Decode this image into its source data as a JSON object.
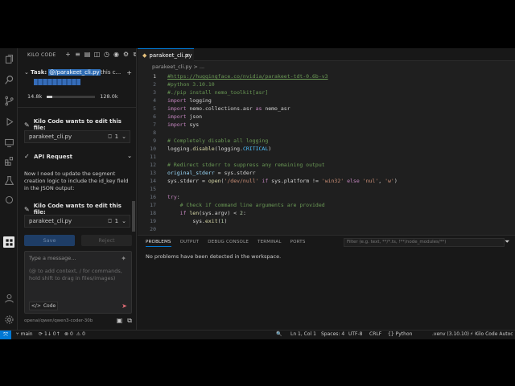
{
  "sidebar": {
    "title": "KILO CODE",
    "task": {
      "label": "Task:",
      "highlight": "@/parakeet_cli.py",
      "rest": "this c...",
      "context_used": "14.8k",
      "context_max": "128.0k",
      "context_fraction": 0.116
    },
    "edit_request_title": "Kilo Code wants to edit this file:",
    "file1": {
      "name": "parakeet_cli.py",
      "count": "1"
    },
    "api_request": "API Request",
    "message": "Now I need to update the segment creation logic to include the id_key field in the JSON output:",
    "file2": {
      "name": "parakeet_cli.py",
      "count": "1"
    },
    "save_label": "Save",
    "reject_label": "Reject",
    "chat_placeholder_title": "Type a message...",
    "chat_placeholder_hint": "(@ to add context, / for commands, hold shift to drag in files/images)",
    "mode_label": "Code",
    "model": "openai/qwen/qwen3-coder-30b"
  },
  "editor": {
    "tab": "parakeet_cli.py",
    "breadcrumb": "parakeet_cli.py > ...",
    "lines": [
      {
        "n": "1",
        "cur": true,
        "parts": [
          {
            "c": "c-link",
            "t": "#https://huggingface.co/nvidia/parakeet-tdt-0.6b-v3"
          }
        ]
      },
      {
        "n": "2",
        "parts": [
          {
            "c": "c-com",
            "t": "#python 3.10.10"
          }
        ]
      },
      {
        "n": "3",
        "parts": [
          {
            "c": "c-com",
            "t": "#./pip install nemo_toolkit[asr]"
          }
        ]
      },
      {
        "n": "4",
        "parts": [
          {
            "c": "c-kw",
            "t": "import"
          },
          {
            "c": "c-txt",
            "t": " logging"
          }
        ]
      },
      {
        "n": "5",
        "parts": [
          {
            "c": "c-kw",
            "t": "import"
          },
          {
            "c": "c-txt",
            "t": " nemo.collections.asr "
          },
          {
            "c": "c-kw",
            "t": "as"
          },
          {
            "c": "c-txt",
            "t": " nemo_asr"
          }
        ]
      },
      {
        "n": "6",
        "parts": [
          {
            "c": "c-kw",
            "t": "import"
          },
          {
            "c": "c-txt",
            "t": " json"
          }
        ]
      },
      {
        "n": "7",
        "parts": [
          {
            "c": "c-kw",
            "t": "import"
          },
          {
            "c": "c-txt",
            "t": " sys"
          }
        ]
      },
      {
        "n": "8",
        "parts": []
      },
      {
        "n": "9",
        "parts": [
          {
            "c": "c-com",
            "t": "# Completely disable all logging"
          }
        ]
      },
      {
        "n": "10",
        "parts": [
          {
            "c": "c-txt",
            "t": "logging."
          },
          {
            "c": "c-fn",
            "t": "disable"
          },
          {
            "c": "c-txt",
            "t": "(logging."
          },
          {
            "c": "c-const",
            "t": "CRITICAL"
          },
          {
            "c": "c-txt",
            "t": ")"
          }
        ]
      },
      {
        "n": "11",
        "parts": []
      },
      {
        "n": "12",
        "parts": [
          {
            "c": "c-com",
            "t": "# Redirect stderr to suppress any remaining output"
          }
        ]
      },
      {
        "n": "13",
        "parts": [
          {
            "c": "c-var",
            "t": "original_stderr"
          },
          {
            "c": "c-txt",
            "t": " = sys.stderr"
          }
        ]
      },
      {
        "n": "14",
        "parts": [
          {
            "c": "c-txt",
            "t": "sys.stderr = "
          },
          {
            "c": "c-fn",
            "t": "open"
          },
          {
            "c": "c-txt",
            "t": "("
          },
          {
            "c": "c-str",
            "t": "'/dev/null'"
          },
          {
            "c": "c-kw",
            "t": " if"
          },
          {
            "c": "c-txt",
            "t": " sys.platform != "
          },
          {
            "c": "c-str",
            "t": "'win32'"
          },
          {
            "c": "c-kw",
            "t": " else"
          },
          {
            "c": "c-str",
            "t": " 'nul'"
          },
          {
            "c": "c-txt",
            "t": ", "
          },
          {
            "c": "c-str",
            "t": "'w'"
          },
          {
            "c": "c-txt",
            "t": ")"
          }
        ]
      },
      {
        "n": "15",
        "parts": []
      },
      {
        "n": "16",
        "parts": [
          {
            "c": "c-kw",
            "t": "try"
          },
          {
            "c": "c-txt",
            "t": ":"
          }
        ]
      },
      {
        "n": "17",
        "parts": [
          {
            "c": "c-com",
            "t": "    # Check if command line arguments are provided"
          }
        ]
      },
      {
        "n": "18",
        "parts": [
          {
            "c": "c-kw",
            "t": "    if"
          },
          {
            "c": "c-fn",
            "t": " len"
          },
          {
            "c": "c-txt",
            "t": "(sys.argv) < "
          },
          {
            "c": "c-num",
            "t": "2"
          },
          {
            "c": "c-txt",
            "t": ":"
          }
        ]
      },
      {
        "n": "19",
        "parts": [
          {
            "c": "c-txt",
            "t": "        sys."
          },
          {
            "c": "c-fn",
            "t": "exit"
          },
          {
            "c": "c-txt",
            "t": "("
          },
          {
            "c": "c-num",
            "t": "1"
          },
          {
            "c": "c-txt",
            "t": ")"
          }
        ]
      },
      {
        "n": "20",
        "parts": []
      }
    ]
  },
  "panel": {
    "tabs": [
      "PROBLEMS",
      "OUTPUT",
      "DEBUG CONSOLE",
      "TERMINAL",
      "PORTS"
    ],
    "filter_placeholder": "Filter (e.g. text, **/*.ts, !**/node_modules/**)",
    "message": "No problems have been detected in the workspace."
  },
  "status": {
    "branch": "main",
    "sync": "1↓ 0↑",
    "errors": "0",
    "warnings": "0",
    "position": "Ln 1, Col 1",
    "spaces": "Spaces: 4",
    "encoding": "UTF-8",
    "eol": "CRLF",
    "language": "Python",
    "interpreter": ".venv (3.10.10)",
    "extension": "Kilo Code Autoc"
  }
}
